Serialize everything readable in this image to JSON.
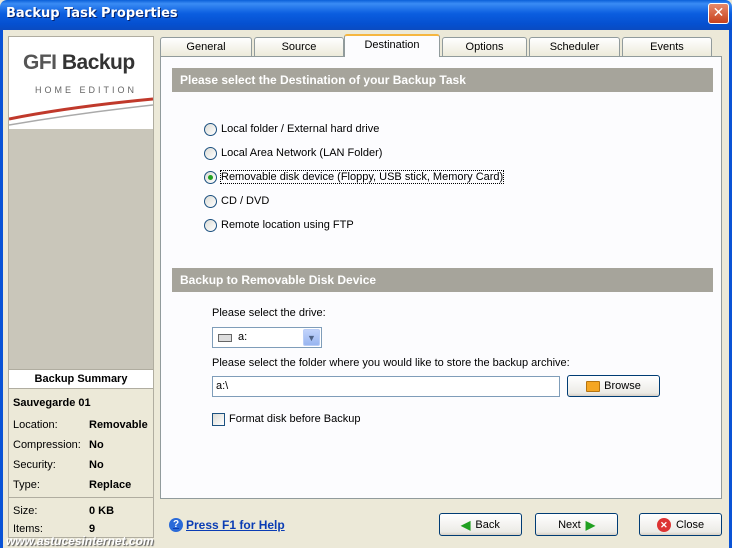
{
  "window": {
    "title": "Backup Task Properties",
    "close_glyph": "✕"
  },
  "logo": {
    "brand_prefix": "GFI",
    "brand_name": "Backup",
    "edition": "HOME EDITION"
  },
  "summary": {
    "heading": "Backup Summary",
    "task_name": "Sauvegarde 01",
    "rows": [
      {
        "key": "Location:",
        "value": "Removable"
      },
      {
        "key": "Compression:",
        "value": "No"
      },
      {
        "key": "Security:",
        "value": "No"
      },
      {
        "key": "Type:",
        "value": "Replace"
      },
      {
        "key": "Size:",
        "value": "0 KB"
      },
      {
        "key": "Items:",
        "value": "9"
      }
    ]
  },
  "tabs": [
    "General",
    "Source",
    "Destination",
    "Options",
    "Scheduler",
    "Events"
  ],
  "active_tab": "Destination",
  "destination": {
    "heading": "Please select the Destination of your Backup Task",
    "options": [
      "Local folder / External hard drive",
      "Local Area Network (LAN Folder)",
      "Removable disk device (Floppy, USB stick, Memory Card)",
      "CD / DVD",
      "Remote location using FTP"
    ],
    "selected_index": 2
  },
  "removable": {
    "heading": "Backup to Removable Disk Device",
    "drive_label": "Please select the drive:",
    "drive_value": "a:",
    "folder_label": "Please select the folder where you would like to store the backup archive:",
    "folder_value": "a:\\",
    "browse_label": "Browse",
    "format_label": "Format disk before Backup",
    "format_checked": false
  },
  "footer": {
    "help_label": "Press F1 for Help",
    "back_label": "Back",
    "next_label": "Next",
    "close_label": "Close"
  },
  "watermark": "www.astucesinternet.com",
  "colors": {
    "titlebar": "#0a5fd8",
    "section_header": "#a6a49b",
    "active_tab_accent": "#f5b640",
    "logo_swoosh": "#c0392b"
  },
  "icons": [
    "drive-icon",
    "folder-icon",
    "back-arrow-icon",
    "next-arrow-icon",
    "close-x-icon",
    "help-icon"
  ]
}
